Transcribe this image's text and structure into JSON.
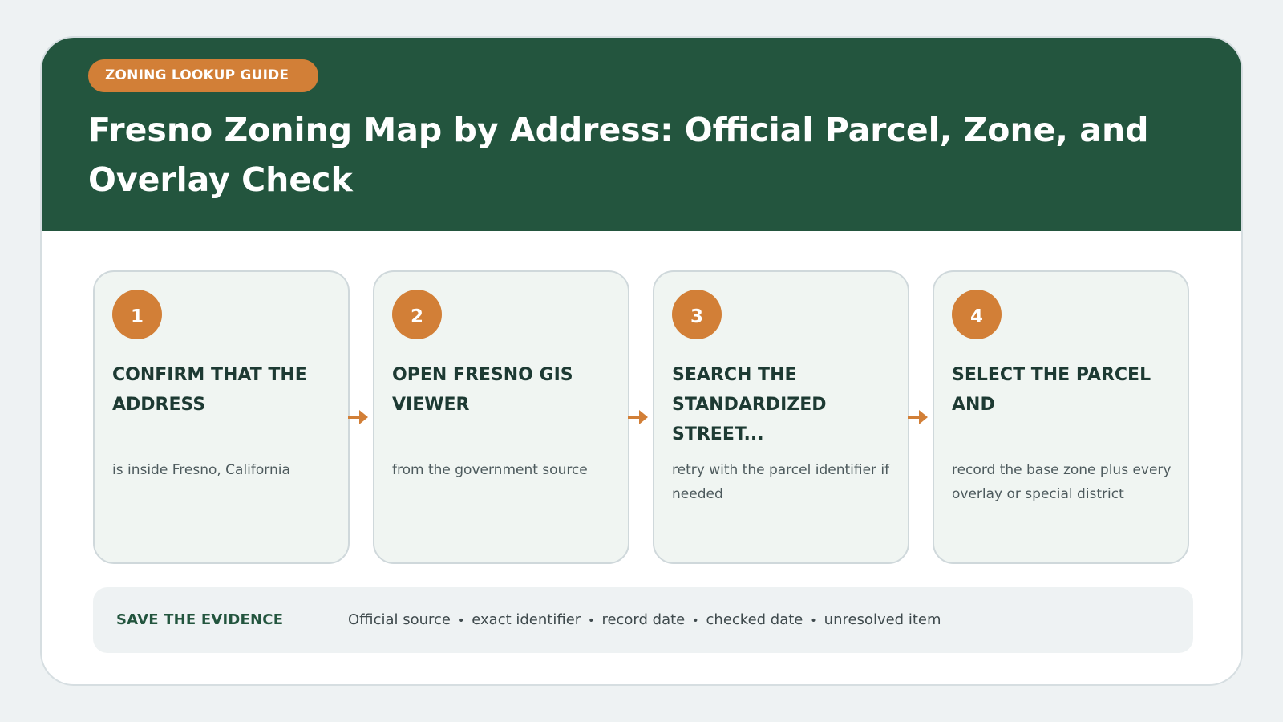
{
  "header": {
    "tag": "ZONING LOOKUP GUIDE",
    "title": "Fresno Zoning Map by Address: Official Parcel, Zone, and Overlay Check"
  },
  "steps": [
    {
      "number": "1",
      "title": "CONFIRM THAT THE ADDRESS",
      "desc": "is inside Fresno, California"
    },
    {
      "number": "2",
      "title": "OPEN FRESNO GIS VIEWER",
      "desc": "from the government source"
    },
    {
      "number": "3",
      "title": "SEARCH THE STANDARDIZED STREET...",
      "desc": "retry with the parcel identifier if needed"
    },
    {
      "number": "4",
      "title": "SELECT THE PARCEL AND",
      "desc": "record the base zone plus every overlay or special district"
    }
  ],
  "evidence": {
    "label": "SAVE THE EVIDENCE",
    "items": [
      "Official source",
      "exact identifier",
      "record date",
      "checked date",
      "unresolved item"
    ],
    "separator": "•"
  },
  "colors": {
    "header_bg": "#23553e",
    "accent": "#d27f37",
    "step_bg": "#f0f5f2",
    "page_bg": "#eef2f3"
  },
  "icons": {
    "connector": "arrow-right-icon"
  }
}
